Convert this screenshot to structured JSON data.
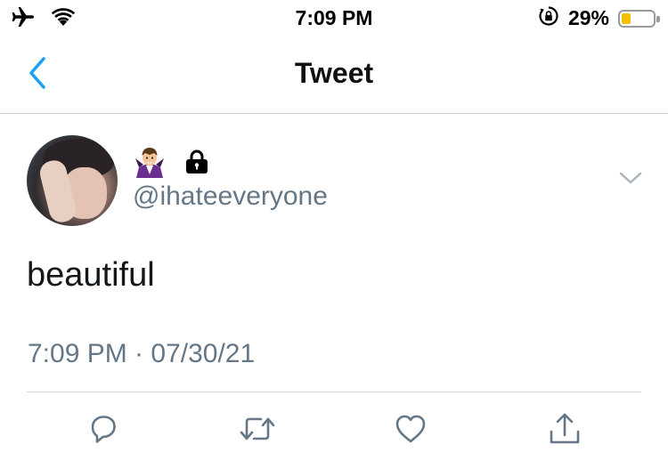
{
  "status_bar": {
    "time": "7:09 PM",
    "battery_percent": "29%",
    "battery_level": 0.29,
    "icons": [
      "airplane-icon",
      "wifi-icon",
      "orientation-lock-icon",
      "battery-icon"
    ]
  },
  "nav": {
    "title": "Tweet",
    "back_icon": "chevron-left-icon",
    "accent_color": "#1da1f2"
  },
  "tweet": {
    "display_name_emoji": "🧛",
    "protected_icon": "lock-icon",
    "handle": "@ihateeveryone",
    "text": "beautiful",
    "timestamp": "7:09 PM · 07/30/21",
    "menu_icon": "chevron-down-icon"
  },
  "actions": [
    {
      "name": "reply",
      "icon": "reply-icon"
    },
    {
      "name": "retweet",
      "icon": "retweet-icon"
    },
    {
      "name": "like",
      "icon": "heart-icon"
    },
    {
      "name": "share",
      "icon": "share-icon"
    }
  ],
  "colors": {
    "secondary_text": "#657786",
    "primary_text": "#14171a",
    "battery_low": "#f2c200"
  }
}
